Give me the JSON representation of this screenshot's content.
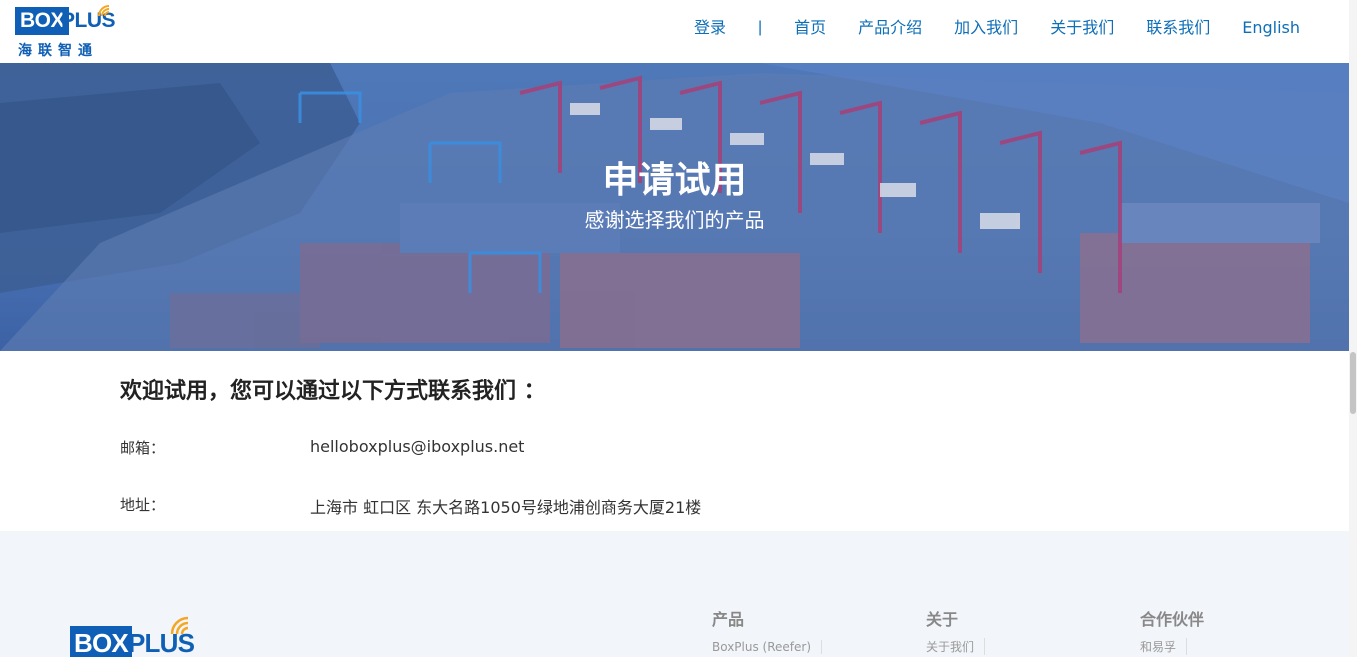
{
  "header": {
    "logo": {
      "brand_box": "BOX",
      "brand_plus": "PLUS",
      "brand_cn": "海联智通"
    },
    "nav": {
      "login": "登录",
      "separator": "|",
      "home": "首页",
      "products": "产品介绍",
      "join": "加入我们",
      "about": "关于我们",
      "contact": "联系我们",
      "english": "English"
    }
  },
  "banner": {
    "title": "申请试用",
    "subtitle": "感谢选择我们的产品"
  },
  "main": {
    "welcome": "欢迎试用，您可以通过以下方式联系我们 ：",
    "email_label": "邮箱：",
    "email_value": "helloboxplus@iboxplus.net",
    "address_label": "地址：",
    "address_value": "上海市 虹口区 东大名路1050号绿地浦创商务大厦21楼"
  },
  "footer": {
    "logo": {
      "brand_box": "BOX",
      "brand_plus": "PLUS"
    },
    "columns": [
      {
        "title": "产品",
        "item": "BoxPlus (Reefer)"
      },
      {
        "title": "关于",
        "item": "关于我们"
      },
      {
        "title": "合作伙伴",
        "item": "和易孚"
      }
    ]
  },
  "colors": {
    "brand_blue": "#0e5fb5",
    "nav_link": "#0e6fb8",
    "banner_overlay": "#4a72b3",
    "footer_bg": "#f2f5f9",
    "wifi_orange": "#f5a623"
  },
  "icons": [
    "wifi-signal-icon"
  ]
}
